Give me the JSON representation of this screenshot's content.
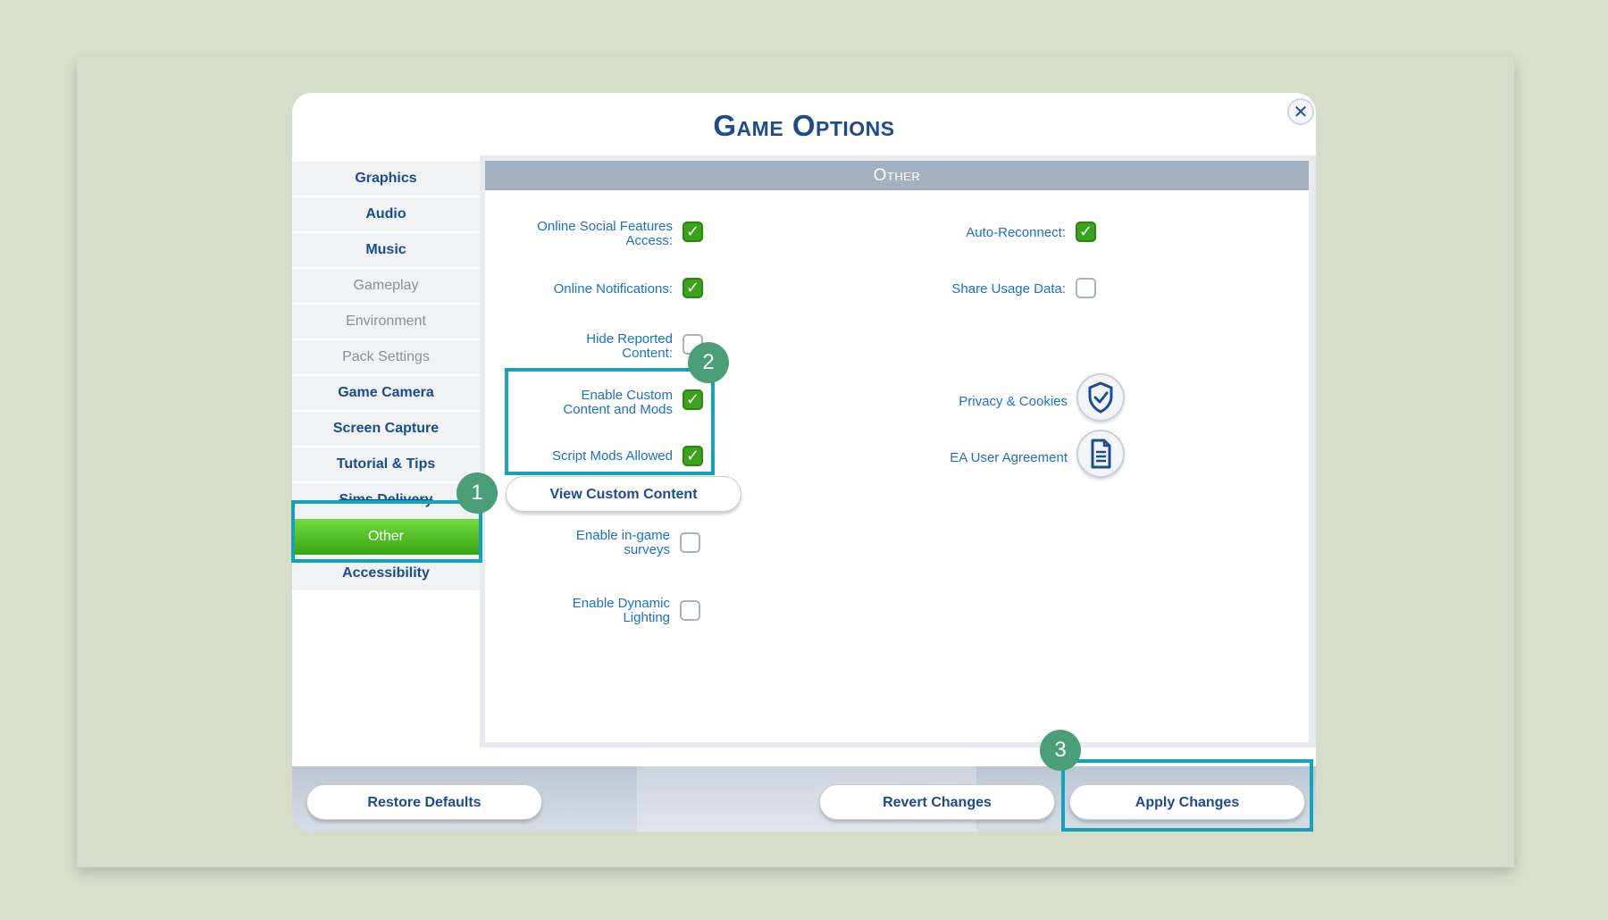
{
  "dialog": {
    "title": "Game Options",
    "close_symbol": "✕"
  },
  "sidebar": {
    "items": [
      {
        "label": "Graphics",
        "state": "enabled"
      },
      {
        "label": "Audio",
        "state": "enabled"
      },
      {
        "label": "Music",
        "state": "enabled"
      },
      {
        "label": "Gameplay",
        "state": "disabled"
      },
      {
        "label": "Environment",
        "state": "disabled"
      },
      {
        "label": "Pack Settings",
        "state": "disabled"
      },
      {
        "label": "Game Camera",
        "state": "enabled"
      },
      {
        "label": "Screen Capture",
        "state": "enabled"
      },
      {
        "label": "Tutorial & Tips",
        "state": "enabled"
      },
      {
        "label": "Sims Delivery",
        "state": "enabled"
      },
      {
        "label": "Other",
        "state": "active"
      },
      {
        "label": "Accessibility",
        "state": "enabled"
      }
    ]
  },
  "section": {
    "header": "Other"
  },
  "options": {
    "online_social": {
      "label": "Online Social Features Access:",
      "checked": true
    },
    "online_notifications": {
      "label": "Online Notifications:",
      "checked": true
    },
    "hide_reported": {
      "label": "Hide Reported Content:",
      "checked": false
    },
    "enable_custom": {
      "label": "Enable Custom Content and Mods",
      "checked": true
    },
    "script_mods": {
      "label": "Script Mods Allowed",
      "checked": true
    },
    "surveys": {
      "label": "Enable in-game surveys",
      "checked": false
    },
    "dynamic_lighting": {
      "label": "Enable Dynamic Lighting",
      "checked": false
    },
    "auto_reconnect": {
      "label": "Auto-Reconnect:",
      "checked": true
    },
    "share_usage": {
      "label": "Share Usage Data:",
      "checked": false
    }
  },
  "links": {
    "privacy": {
      "label": "Privacy & Cookies",
      "icon": "shield-check-icon"
    },
    "user_agreement": {
      "label": "EA User Agreement",
      "icon": "document-icon"
    }
  },
  "buttons": {
    "view_custom_content": "View Custom Content",
    "restore_defaults": "Restore Defaults",
    "revert_changes": "Revert Changes",
    "apply_changes": "Apply Changes"
  },
  "annotations": {
    "badge_1": "1",
    "badge_2": "2",
    "badge_3": "3",
    "highlight_color": "#15a3b8",
    "badge_color": "#4a9f78"
  },
  "colors": {
    "accent_blue": "#1c4a93",
    "label_blue": "#1e6fc8",
    "active_green": "#3ba21c",
    "header_gray": "#a5b0bf"
  }
}
